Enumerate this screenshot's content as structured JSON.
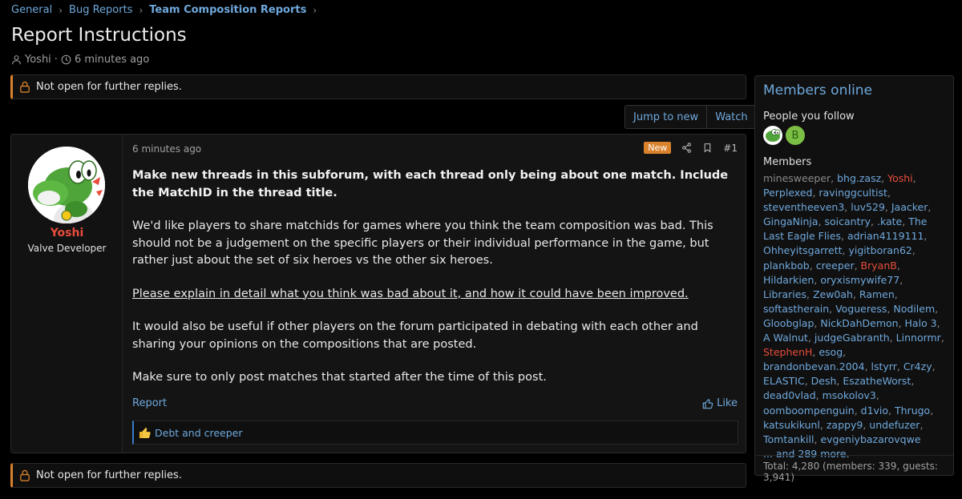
{
  "breadcrumb": [
    "General",
    "Bug Reports",
    "Team Composition Reports"
  ],
  "thread": {
    "title": "Report Instructions",
    "author": "Yoshi",
    "time": "6 minutes ago"
  },
  "notice": "Not open for further replies.",
  "buttons": {
    "jump_to_new": "Jump to new",
    "watch": "Watch"
  },
  "post": {
    "username": "Yoshi",
    "user_title": "Valve Developer",
    "time": "6 minutes ago",
    "badge": "New",
    "number": "#1",
    "paragraphs": [
      "Make new threads in this subforum, with each thread only being about one match. Include the MatchID in the thread title.",
      "We'd like players to share matchids for games where you think the team composition was bad. This should not be a judgement on the specific players or their individual performance in the game, but rather just about the set of six heroes vs the other six heroes.",
      "Please explain in detail what you think was bad about it, and how it could have been improved.",
      "It would also be useful if other players on the forum participated in debating with each other and sharing your opinions on the compositions that are posted.",
      "Make sure to only post matches that started after the time of this post."
    ],
    "report_label": "Report",
    "like_label": "Like",
    "reactions_text": "Debt and creeper",
    "colors": {
      "username": "#e74c3c",
      "badge": "#d9822b",
      "link": "#6fa8dc"
    }
  },
  "sidebar": {
    "title": "Members online",
    "people_you_follow": "People you follow",
    "follow_avatar_letter": "B",
    "members_label": "Members",
    "members": [
      {
        "name": "minesweeper",
        "style": "plain"
      },
      {
        "name": "bhg.zasz",
        "style": "link"
      },
      {
        "name": "Yoshi",
        "style": "red"
      },
      {
        "name": "Perplexed",
        "style": "link"
      },
      {
        "name": "ravinggcultist",
        "style": "link"
      },
      {
        "name": "steventheeven3",
        "style": "link"
      },
      {
        "name": "luv529",
        "style": "link"
      },
      {
        "name": "Jaacker",
        "style": "link"
      },
      {
        "name": "GingaNinja",
        "style": "link"
      },
      {
        "name": "soicantry",
        "style": "link"
      },
      {
        "name": ".kate",
        "style": "link"
      },
      {
        "name": "The Last Eagle Flies",
        "style": "link"
      },
      {
        "name": "adrian4119111",
        "style": "link"
      },
      {
        "name": "Ohheyitsgarrett",
        "style": "link"
      },
      {
        "name": "yigitboran62",
        "style": "link"
      },
      {
        "name": "plankbob",
        "style": "link"
      },
      {
        "name": "creeper",
        "style": "link"
      },
      {
        "name": "BryanB",
        "style": "red"
      },
      {
        "name": "Hildarkien",
        "style": "link"
      },
      {
        "name": "oryxismywife77",
        "style": "link"
      },
      {
        "name": "Libraries",
        "style": "link"
      },
      {
        "name": "Zew0ah",
        "style": "link"
      },
      {
        "name": "Ramen",
        "style": "link"
      },
      {
        "name": "softastherain",
        "style": "link"
      },
      {
        "name": "Vogueress",
        "style": "link"
      },
      {
        "name": "Nodilem",
        "style": "link"
      },
      {
        "name": "Gloobglap",
        "style": "link"
      },
      {
        "name": "NickDahDemon",
        "style": "link"
      },
      {
        "name": "Halo 3",
        "style": "link"
      },
      {
        "name": "A Walnut",
        "style": "link"
      },
      {
        "name": "judgeGabranth",
        "style": "link"
      },
      {
        "name": "Linnormr",
        "style": "link"
      },
      {
        "name": "StephenH",
        "style": "red"
      },
      {
        "name": "esog",
        "style": "link"
      },
      {
        "name": "brandonbevan.2004",
        "style": "link"
      },
      {
        "name": "lstyrr",
        "style": "link"
      },
      {
        "name": "Cr4zy",
        "style": "link"
      },
      {
        "name": "ELASTIC",
        "style": "link"
      },
      {
        "name": "Desh",
        "style": "link"
      },
      {
        "name": "EszatheWorst",
        "style": "link"
      },
      {
        "name": "dead0vlad",
        "style": "link"
      },
      {
        "name": "msokolov3",
        "style": "link"
      },
      {
        "name": "oomboompenguin",
        "style": "link"
      },
      {
        "name": "d1vio",
        "style": "link"
      },
      {
        "name": "Thrugo",
        "style": "link"
      },
      {
        "name": "katsukikunl",
        "style": "link"
      },
      {
        "name": "zappy9",
        "style": "link"
      },
      {
        "name": "undefuzer",
        "style": "link"
      },
      {
        "name": "Tomtankill",
        "style": "link"
      },
      {
        "name": "evgeniybazarovqwe",
        "style": "link"
      }
    ],
    "more": "... and 289 more.",
    "total": "Total: 4,280 (members: 339, guests: 3,941)"
  },
  "icons": [
    "chevron-right-icon",
    "user-icon",
    "clock-icon",
    "lock-icon",
    "share-icon",
    "bookmark-icon",
    "thumbs-up-icon",
    "like-reaction-icon"
  ]
}
